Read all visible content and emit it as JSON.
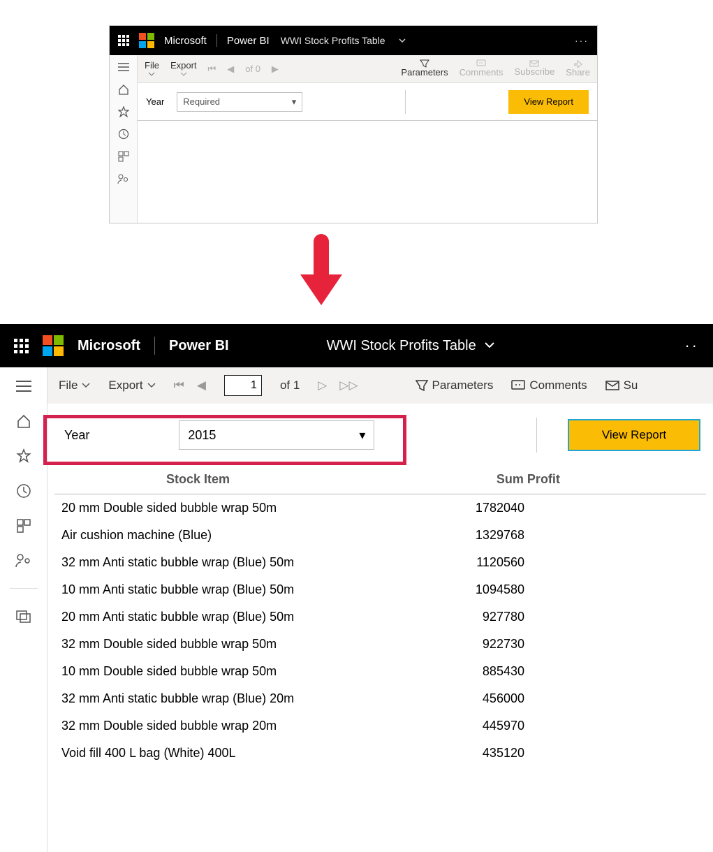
{
  "brand_ms": "Microsoft",
  "brand_pbi": "Power BI",
  "report_title": "WWI Stock Profits Table",
  "panel_a": {
    "menu_file": "File",
    "menu_export": "Export",
    "pager_of": "of 0",
    "parameters": "Parameters",
    "comments": "Comments",
    "subscribe": "Subscribe",
    "share": "Share",
    "param_label": "Year",
    "param_placeholder": "Required",
    "view_report": "View Report"
  },
  "panel_b": {
    "menu_file": "File",
    "menu_export": "Export",
    "page_current": "1",
    "pager_of": "of 1",
    "parameters": "Parameters",
    "comments": "Comments",
    "subscribe_partial": "Su",
    "param_label": "Year",
    "param_value": "2015",
    "view_report": "View Report",
    "col_item": "Stock Item",
    "col_profit": "Sum Profit",
    "rows": [
      {
        "item": "20 mm Double sided bubble wrap 50m",
        "profit": "1782040"
      },
      {
        "item": "Air cushion machine (Blue)",
        "profit": "1329768"
      },
      {
        "item": "32 mm Anti static bubble wrap (Blue) 50m",
        "profit": "1120560"
      },
      {
        "item": "10 mm Anti static bubble wrap (Blue) 50m",
        "profit": "1094580"
      },
      {
        "item": "20 mm Anti static bubble wrap (Blue) 50m",
        "profit": "927780"
      },
      {
        "item": "32 mm Double sided bubble wrap 50m",
        "profit": "922730"
      },
      {
        "item": "10 mm Double sided bubble wrap 50m",
        "profit": "885430"
      },
      {
        "item": "32 mm Anti static bubble wrap (Blue) 20m",
        "profit": "456000"
      },
      {
        "item": "32 mm Double sided bubble wrap 20m",
        "profit": "445970"
      },
      {
        "item": "Void fill 400 L bag (White) 400L",
        "profit": "435120"
      }
    ]
  }
}
